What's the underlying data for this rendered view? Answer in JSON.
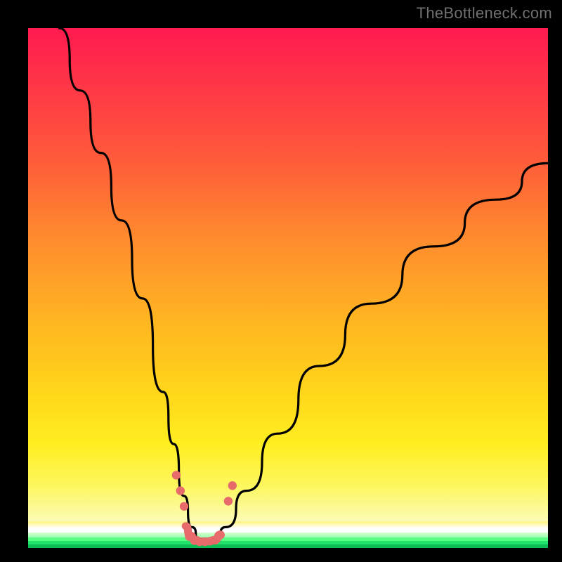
{
  "watermark": "TheBottleneck.com",
  "chart_data": {
    "type": "line",
    "title": "",
    "xlabel": "",
    "ylabel": "",
    "xlim": [
      0,
      100
    ],
    "ylim": [
      0,
      100
    ],
    "grid": false,
    "legend": false,
    "background_gradient": {
      "orientation": "vertical",
      "stops": [
        {
          "pos": 0.0,
          "color": "#ff1a4f"
        },
        {
          "pos": 0.25,
          "color": "#ff5a3a"
        },
        {
          "pos": 0.55,
          "color": "#ffb222"
        },
        {
          "pos": 0.8,
          "color": "#ffee20"
        },
        {
          "pos": 0.94,
          "color": "#fcfbaa"
        },
        {
          "pos": 0.97,
          "color": "#ffffff"
        },
        {
          "pos": 0.985,
          "color": "#9bffb0"
        },
        {
          "pos": 1.0,
          "color": "#0bbc52"
        }
      ]
    },
    "series": [
      {
        "name": "bottleneck-curve",
        "color": "#000000",
        "x": [
          6,
          10,
          14,
          18,
          22,
          26,
          28,
          30,
          31.5,
          33,
          34.5,
          36,
          38,
          42,
          48,
          56,
          66,
          78,
          90,
          100
        ],
        "y": [
          100,
          88,
          76,
          63,
          48,
          30,
          20,
          10,
          4,
          1.5,
          1.2,
          1.5,
          4,
          11,
          22,
          35,
          47,
          58,
          67,
          74
        ]
      }
    ],
    "markers": {
      "name": "highlight-dots",
      "color": "#e86b6b",
      "points": [
        {
          "x": 28.5,
          "y": 14
        },
        {
          "x": 29.3,
          "y": 11
        },
        {
          "x": 30.0,
          "y": 8
        },
        {
          "x": 31.0,
          "y": 2.2
        },
        {
          "x": 32.0,
          "y": 1.4
        },
        {
          "x": 33.0,
          "y": 1.2
        },
        {
          "x": 34.0,
          "y": 1.2
        },
        {
          "x": 35.0,
          "y": 1.3
        },
        {
          "x": 36.0,
          "y": 1.5
        },
        {
          "x": 37.0,
          "y": 2.5
        },
        {
          "x": 38.5,
          "y": 9
        },
        {
          "x": 39.3,
          "y": 12
        }
      ]
    },
    "minimum": {
      "x": 33.5,
      "y": 1.2
    }
  }
}
